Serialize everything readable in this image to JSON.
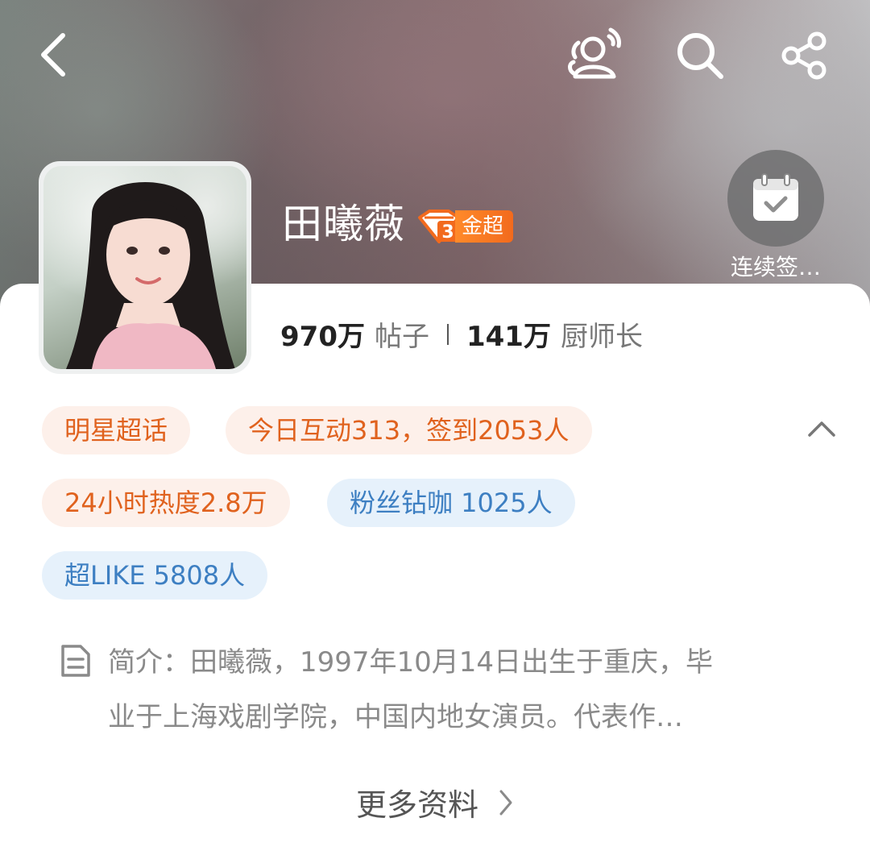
{
  "header": {
    "back_icon": "chevron-left-icon",
    "actions": [
      "group-chat-icon",
      "search-icon",
      "share-icon"
    ]
  },
  "profile": {
    "name": "田曦薇",
    "badge_level": "3",
    "badge_text": "金超",
    "checkin_label": "连续签…"
  },
  "stats": {
    "posts_count": "970万",
    "posts_label": "帖子",
    "members_count": "141万",
    "members_label": "厨师长"
  },
  "tags": {
    "t1": "明星超话",
    "t2": "今日互动313，签到2053人",
    "t3": "24小时热度2.8万",
    "t4": "粉丝钻咖 1025人",
    "t5": "超LIKE 5808人"
  },
  "intro": {
    "line1": "简介：田曦薇，1997年10月14日出生于重庆，毕",
    "line2": "业于上海戏剧学院，中国内地女演员。代表作…"
  },
  "more_label": "更多资料",
  "colors": {
    "accent_orange": "#e0621e",
    "tag_blue": "#3d7fc2",
    "badge_orange": "#f26a1d"
  }
}
